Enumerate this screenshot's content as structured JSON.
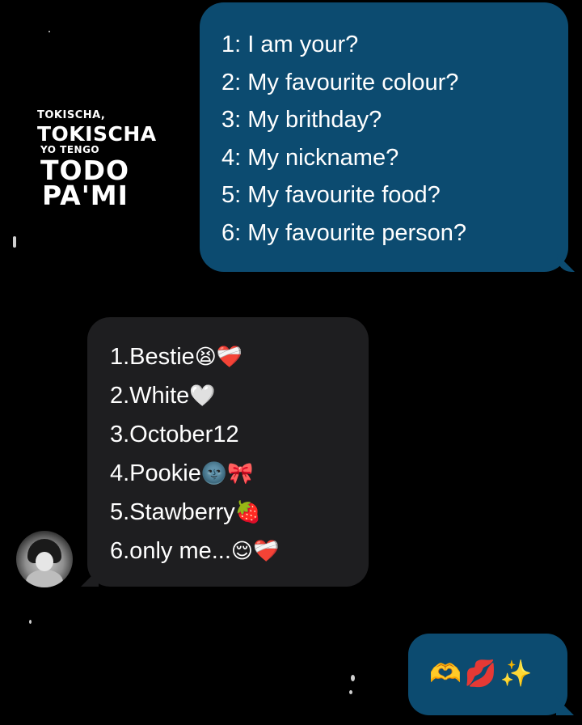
{
  "overlay": {
    "line1": "TOKISCHA,",
    "line2": "TOKISCHA",
    "line3": "YO TENGO",
    "line4": "TODO",
    "line5": "PA'MI"
  },
  "question_bubble": {
    "lines": [
      "1: I am your?",
      "2: My favourite colour?",
      "3: My brithday?",
      "4: My nickname?",
      "5: My favourite food?",
      "6: My favourite person?"
    ]
  },
  "answer_bubble": {
    "lines": [
      {
        "text": "1.Bestie",
        "emoji": "😫❤️‍🩹"
      },
      {
        "text": "2.White",
        "emoji": "🤍"
      },
      {
        "text": "3.October12",
        "emoji": ""
      },
      {
        "text": "4.Pookie",
        "emoji": "🌚🎀"
      },
      {
        "text": "5.Stawberry",
        "emoji": "🍓"
      },
      {
        "text": "6.only me...",
        "emoji": "😌❤️‍🩹"
      }
    ]
  },
  "reaction_bubble": {
    "text": "🫶💋✨"
  },
  "colors": {
    "sent_bubble": "#0c4b70",
    "received_bubble": "#1e1e20",
    "background": "#000000"
  }
}
